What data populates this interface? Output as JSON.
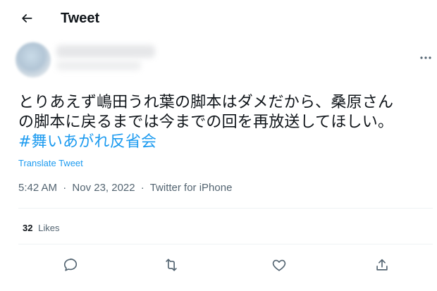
{
  "header": {
    "title": "Tweet",
    "back_icon": "arrow-left-icon"
  },
  "author": {
    "more_icon": "more-horizontal-icon"
  },
  "tweet": {
    "text_line_1": "とりあえず嶋田うれ葉の脚本はダメだから、桑原さん",
    "text_line_2": "の脚本に戻るまでは今までの回を再放送してほしい。",
    "hashtag": "#舞いあがれ反省会",
    "translate_label": "Translate Tweet",
    "time": "5:42 AM",
    "date": "Nov 23, 2022",
    "source": "Twitter for iPhone",
    "separator": "·"
  },
  "stats": {
    "likes_count": "32",
    "likes_label": "Likes"
  },
  "actions": {
    "reply_icon": "reply-icon",
    "retweet_icon": "retweet-icon",
    "like_icon": "heart-icon",
    "share_icon": "share-icon"
  },
  "colors": {
    "accent": "#1d9bf0",
    "text_primary": "#0f1419",
    "text_secondary": "#536471",
    "divider": "#eff3f4"
  }
}
